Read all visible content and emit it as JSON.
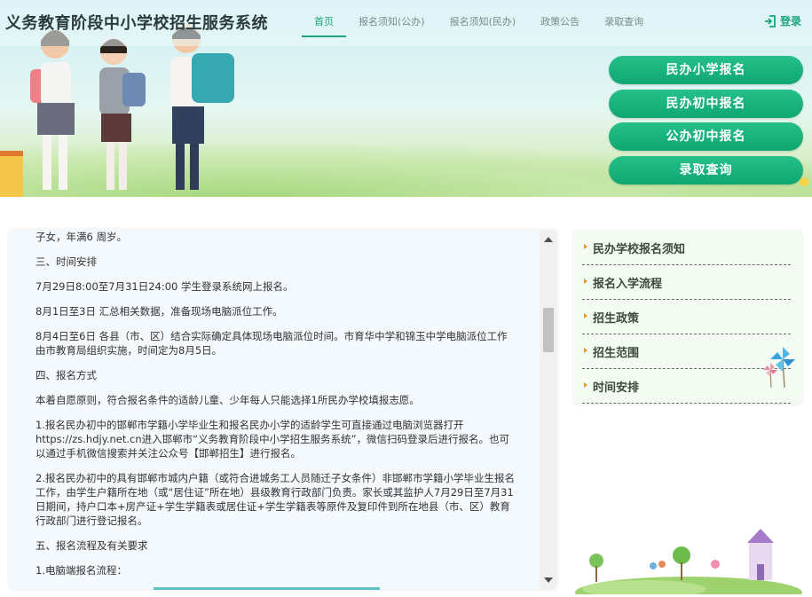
{
  "header": {
    "site_title": "义务教育阶段中小学校招生服务系统",
    "nav": [
      {
        "label": "首页",
        "active": true
      },
      {
        "label": "报名须知(公办)",
        "active": false
      },
      {
        "label": "报名须知(民办)",
        "active": false
      },
      {
        "label": "政策公告",
        "active": false
      },
      {
        "label": "录取查询",
        "active": false
      }
    ],
    "login_label": "登录"
  },
  "actions": [
    {
      "label": "民办小学报名"
    },
    {
      "label": "民办初中报名"
    },
    {
      "label": "公办初中报名"
    },
    {
      "label": "录取查询"
    }
  ],
  "content": {
    "paragraphs": [
      "子女，年满6 周岁。",
      "三、时间安排",
      "7月29日8:00至7月31日24:00 学生登录系统网上报名。",
      "8月1日至3日  汇总相关数据，准备现场电脑派位工作。",
      "8月4日至6日  各县（市、区）结合实际确定具体现场电脑派位时间。市育华中学和锦玉中学电脑派位工作由市教育局组织实施，时间定为8月5日。",
      "四、报名方式",
      "本着自愿原则，符合报名条件的适龄儿童、少年每人只能选择1所民办学校填报志愿。",
      "1.报名民办初中的邯郸市学籍小学毕业生和报名民办小学的适龄学生可直接通过电脑浏览器打开https://zs.hdjy.net.cn进入邯郸市“义务教育阶段中小学招生服务系统”，微信扫码登录后进行报名。也可以通过手机微信搜索并关注公众号【邯郸招生】进行报名。",
      "2.报名民办初中的具有邯郸市城内户籍（或符合进城务工人员随迁子女条件）非邯郸市学籍小学毕业生报名工作，由学生户籍所在地（或“居住证”所在地）县级教育行政部门负责。家长或其监护人7月29日至7月31日期间，持户口本+房产证+学生学籍表或居住证+学生学籍表等原件及复印件到所在地县（市、区）教育行政部门进行登记报名。",
      "五、报名流程及有关要求",
      "1.电脑端报名流程："
    ]
  },
  "sidebar": {
    "items": [
      {
        "label": "民办学校报名须知"
      },
      {
        "label": "报名入学流程"
      },
      {
        "label": "招生政策"
      },
      {
        "label": "招生范围"
      },
      {
        "label": "时间安排"
      }
    ]
  },
  "colors": {
    "accent": "#1aa67a",
    "button": "#17b07c",
    "sidebar_bullet": "#e39a2c"
  }
}
